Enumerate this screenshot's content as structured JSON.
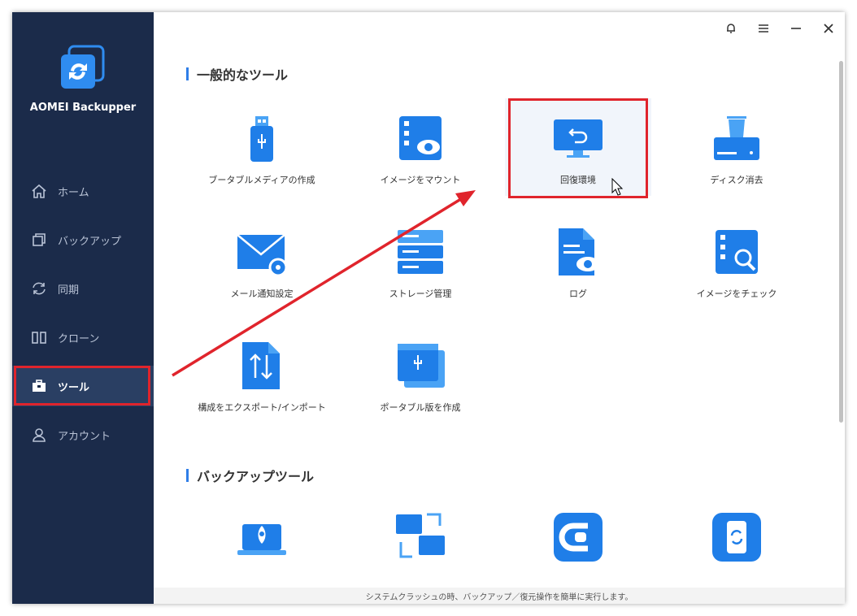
{
  "app": {
    "name": "AOMEI Backupper"
  },
  "sidebar": {
    "items": [
      {
        "label": "ホーム",
        "icon": "home-icon"
      },
      {
        "label": "バックアップ",
        "icon": "backup-icon"
      },
      {
        "label": "同期",
        "icon": "sync-icon"
      },
      {
        "label": "クローン",
        "icon": "clone-icon"
      },
      {
        "label": "ツール",
        "icon": "toolbox-icon",
        "active": true
      },
      {
        "label": "アカウント",
        "icon": "user-icon"
      }
    ]
  },
  "sections": {
    "general_title": "一般的なツール",
    "backup_title": "バックアップツール"
  },
  "tools": {
    "bootable_media": "ブータブルメディアの作成",
    "mount_image": "イメージをマウント",
    "recovery_env": "回復環境",
    "disk_wipe": "ディスク消去",
    "mail_settings": "メール通知設定",
    "storage_mgmt": "ストレージ管理",
    "log": "ログ",
    "check_image": "イメージをチェック",
    "export_import": "構成をエクスポート/インポート",
    "portable": "ポータブル版を作成"
  },
  "status_text": "システムクラッシュの時、バックアップ／復元操作を簡単に実行します。",
  "colors": {
    "sidebar": "#1b2b4a",
    "accent": "#2f7ee8",
    "highlight": "#e0242c"
  }
}
